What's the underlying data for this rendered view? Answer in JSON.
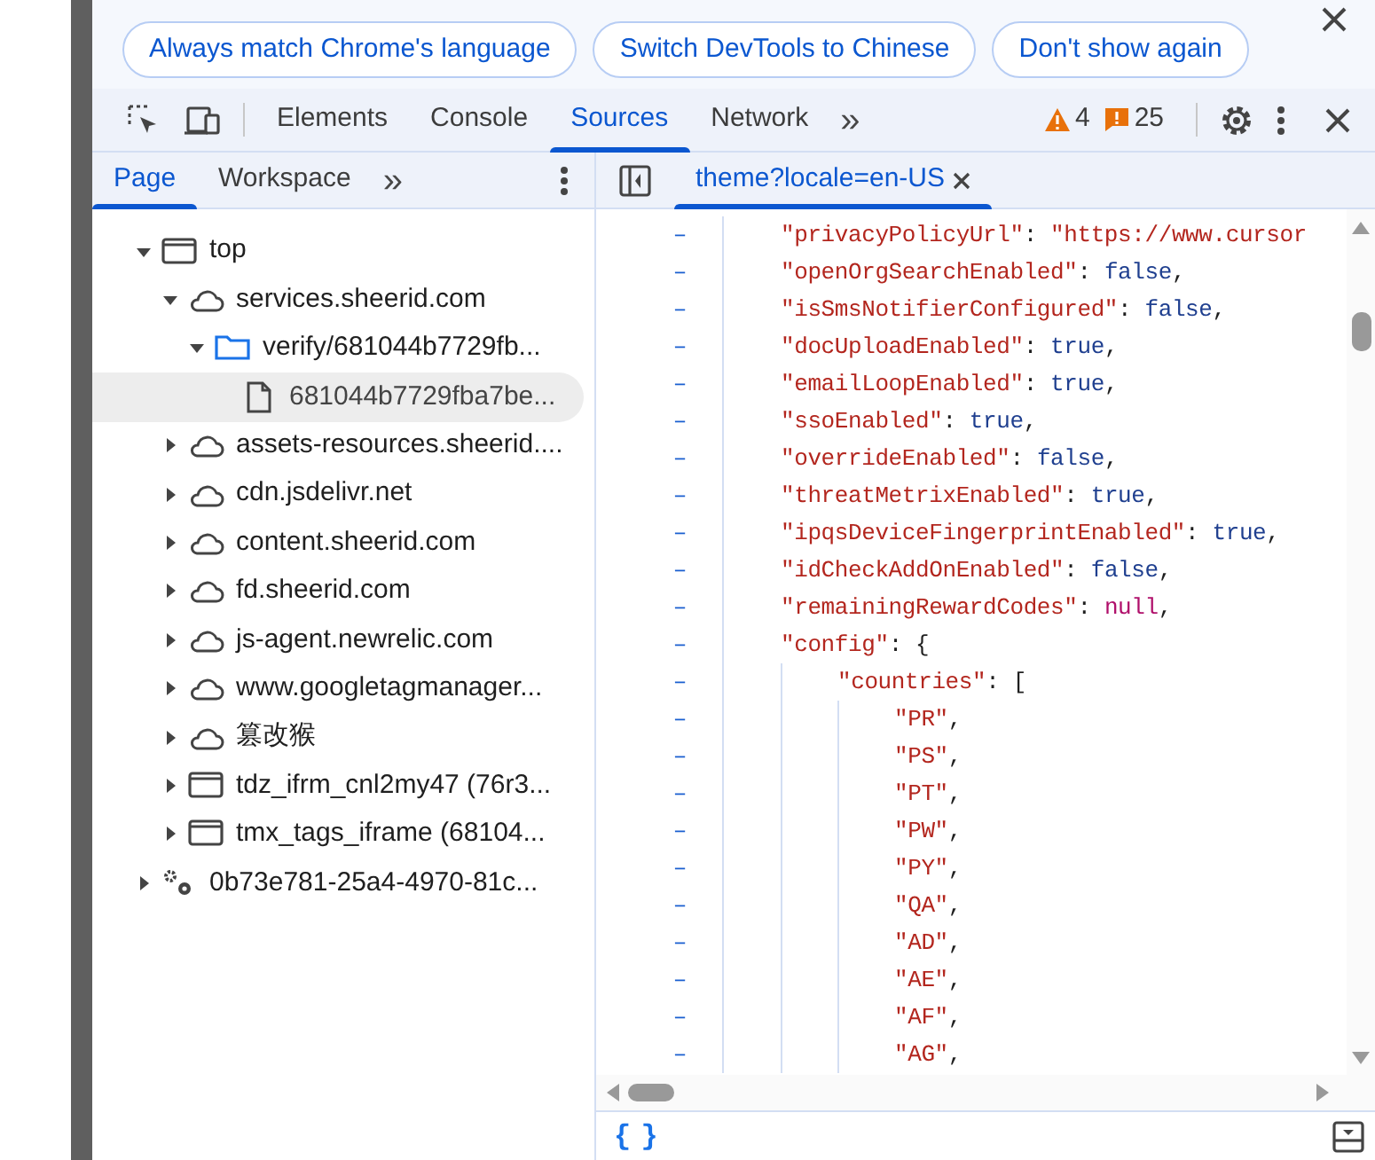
{
  "infobar": {
    "buttons": [
      "Always match Chrome's language",
      "Switch DevTools to Chinese",
      "Don't show again"
    ]
  },
  "toolbar": {
    "tabs": [
      {
        "label": "Elements",
        "selected": false
      },
      {
        "label": "Console",
        "selected": false
      },
      {
        "label": "Sources",
        "selected": true
      },
      {
        "label": "Network",
        "selected": false
      }
    ],
    "more": "»",
    "warnings": "4",
    "issues": "25"
  },
  "navigator": {
    "tabs": [
      {
        "label": "Page",
        "selected": true
      },
      {
        "label": "Workspace",
        "selected": false
      }
    ],
    "more": "»",
    "tree": [
      {
        "kind": "frame",
        "label": "top",
        "expanded": true,
        "selected": false,
        "children": [
          {
            "kind": "domain",
            "label": "services.sheerid.com",
            "expanded": true,
            "selected": false,
            "children": [
              {
                "kind": "folder",
                "label": "verify/681044b7729fb...",
                "expanded": true,
                "selected": false,
                "children": [
                  {
                    "kind": "file",
                    "label": "681044b7729fba7be...",
                    "selected": true
                  }
                ]
              }
            ]
          },
          {
            "kind": "domain",
            "label": "assets-resources.sheerid....",
            "expanded": false,
            "selected": false
          },
          {
            "kind": "domain",
            "label": "cdn.jsdelivr.net",
            "expanded": false,
            "selected": false
          },
          {
            "kind": "domain",
            "label": "content.sheerid.com",
            "expanded": false,
            "selected": false
          },
          {
            "kind": "domain",
            "label": "fd.sheerid.com",
            "expanded": false,
            "selected": false
          },
          {
            "kind": "domain",
            "label": "js-agent.newrelic.com",
            "expanded": false,
            "selected": false
          },
          {
            "kind": "domain",
            "label": "www.googletagmanager...",
            "expanded": false,
            "selected": false
          },
          {
            "kind": "domain",
            "label": "篡改猴",
            "expanded": false,
            "selected": false
          },
          {
            "kind": "frame",
            "label": "tdz_ifrm_cnl2my47 (76r3...",
            "expanded": false,
            "selected": false
          },
          {
            "kind": "frame",
            "label": "tmx_tags_iframe (68104...",
            "expanded": false,
            "selected": false
          }
        ]
      },
      {
        "kind": "extension",
        "label": "0b73e781-25a4-4970-81c...",
        "expanded": false,
        "selected": false
      }
    ]
  },
  "editor": {
    "tab": {
      "label": "theme?locale=en-US",
      "selected": true
    },
    "lines": [
      {
        "tokens": [
          {
            "kind": "key",
            "text": "\"privacyPolicyUrl\""
          },
          {
            "kind": "punct",
            "text": ": "
          },
          {
            "kind": "string",
            "text": "\"https://www.cursor"
          }
        ]
      },
      {
        "tokens": [
          {
            "kind": "key",
            "text": "\"openOrgSearchEnabled\""
          },
          {
            "kind": "punct",
            "text": ": "
          },
          {
            "kind": "literal",
            "text": "false"
          },
          {
            "kind": "punct",
            "text": ","
          }
        ]
      },
      {
        "tokens": [
          {
            "kind": "key",
            "text": "\"isSmsNotifierConfigured\""
          },
          {
            "kind": "punct",
            "text": ": "
          },
          {
            "kind": "literal",
            "text": "false"
          },
          {
            "kind": "punct",
            "text": ","
          }
        ]
      },
      {
        "tokens": [
          {
            "kind": "key",
            "text": "\"docUploadEnabled\""
          },
          {
            "kind": "punct",
            "text": ": "
          },
          {
            "kind": "literal",
            "text": "true"
          },
          {
            "kind": "punct",
            "text": ","
          }
        ]
      },
      {
        "tokens": [
          {
            "kind": "key",
            "text": "\"emailLoopEnabled\""
          },
          {
            "kind": "punct",
            "text": ": "
          },
          {
            "kind": "literal",
            "text": "true"
          },
          {
            "kind": "punct",
            "text": ","
          }
        ]
      },
      {
        "tokens": [
          {
            "kind": "key",
            "text": "\"ssoEnabled\""
          },
          {
            "kind": "punct",
            "text": ": "
          },
          {
            "kind": "literal",
            "text": "true"
          },
          {
            "kind": "punct",
            "text": ","
          }
        ]
      },
      {
        "tokens": [
          {
            "kind": "key",
            "text": "\"overrideEnabled\""
          },
          {
            "kind": "punct",
            "text": ": "
          },
          {
            "kind": "literal",
            "text": "false"
          },
          {
            "kind": "punct",
            "text": ","
          }
        ]
      },
      {
        "tokens": [
          {
            "kind": "key",
            "text": "\"threatMetrixEnabled\""
          },
          {
            "kind": "punct",
            "text": ": "
          },
          {
            "kind": "literal",
            "text": "true"
          },
          {
            "kind": "punct",
            "text": ","
          }
        ]
      },
      {
        "tokens": [
          {
            "kind": "key",
            "text": "\"ipqsDeviceFingerprintEnabled\""
          },
          {
            "kind": "punct",
            "text": ": "
          },
          {
            "kind": "literal",
            "text": "true"
          },
          {
            "kind": "punct",
            "text": ","
          }
        ]
      },
      {
        "tokens": [
          {
            "kind": "key",
            "text": "\"idCheckAddOnEnabled\""
          },
          {
            "kind": "punct",
            "text": ": "
          },
          {
            "kind": "literal",
            "text": "false"
          },
          {
            "kind": "punct",
            "text": ","
          }
        ]
      },
      {
        "tokens": [
          {
            "kind": "key",
            "text": "\"remainingRewardCodes\""
          },
          {
            "kind": "punct",
            "text": ": "
          },
          {
            "kind": "null",
            "text": "null"
          },
          {
            "kind": "punct",
            "text": ","
          }
        ]
      },
      {
        "tokens": [
          {
            "kind": "key",
            "text": "\"config\""
          },
          {
            "kind": "punct",
            "text": ": {"
          }
        ],
        "children": [
          {
            "tokens": [
              {
                "kind": "key",
                "text": "\"countries\""
              },
              {
                "kind": "punct",
                "text": ": ["
              }
            ],
            "children": [
              {
                "tokens": [
                  {
                    "kind": "string",
                    "text": "\"PR\""
                  },
                  {
                    "kind": "punct",
                    "text": ","
                  }
                ]
              },
              {
                "tokens": [
                  {
                    "kind": "string",
                    "text": "\"PS\""
                  },
                  {
                    "kind": "punct",
                    "text": ","
                  }
                ]
              },
              {
                "tokens": [
                  {
                    "kind": "string",
                    "text": "\"PT\""
                  },
                  {
                    "kind": "punct",
                    "text": ","
                  }
                ]
              },
              {
                "tokens": [
                  {
                    "kind": "string",
                    "text": "\"PW\""
                  },
                  {
                    "kind": "punct",
                    "text": ","
                  }
                ]
              },
              {
                "tokens": [
                  {
                    "kind": "string",
                    "text": "\"PY\""
                  },
                  {
                    "kind": "punct",
                    "text": ","
                  }
                ]
              },
              {
                "tokens": [
                  {
                    "kind": "string",
                    "text": "\"QA\""
                  },
                  {
                    "kind": "punct",
                    "text": ","
                  }
                ]
              },
              {
                "tokens": [
                  {
                    "kind": "string",
                    "text": "\"AD\""
                  },
                  {
                    "kind": "punct",
                    "text": ","
                  }
                ]
              },
              {
                "tokens": [
                  {
                    "kind": "string",
                    "text": "\"AE\""
                  },
                  {
                    "kind": "punct",
                    "text": ","
                  }
                ]
              },
              {
                "tokens": [
                  {
                    "kind": "string",
                    "text": "\"AF\""
                  },
                  {
                    "kind": "punct",
                    "text": ","
                  }
                ]
              },
              {
                "tokens": [
                  {
                    "kind": "string",
                    "text": "\"AG\""
                  },
                  {
                    "kind": "punct",
                    "text": ","
                  }
                ]
              }
            ]
          }
        ]
      }
    ],
    "gutter_mark": "–"
  },
  "footer": {
    "format_button": "{ }"
  }
}
